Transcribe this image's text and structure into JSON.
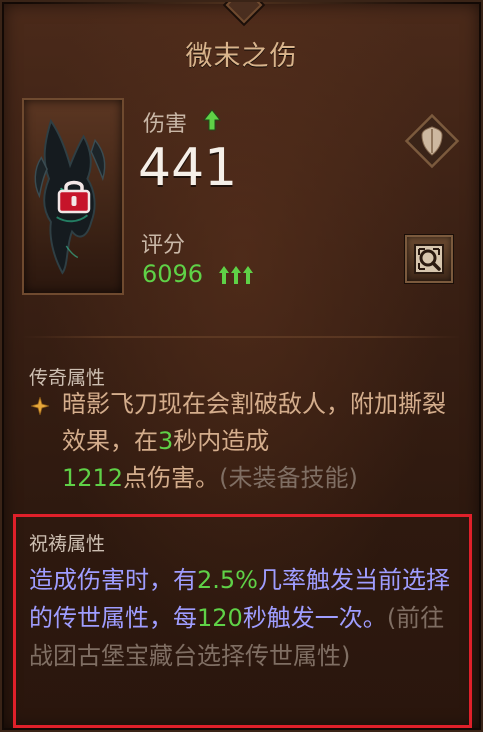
{
  "item": {
    "name": "微末之伤"
  },
  "stats": {
    "damage_label": "伤害",
    "damage_value": "441",
    "score_label": "评分",
    "score_value": "6096"
  },
  "icons": {
    "lock": "lock-icon",
    "compare": "shield-compare-icon",
    "inspect": "inspect-icon",
    "upgrade": "green-arrow-up-icon"
  },
  "colors": {
    "upgrade_green": "#5fd147",
    "prayer_blue": "#9f9dff",
    "highlight_red": "#e0202a",
    "lock_red": "#c6142a"
  },
  "legendary": {
    "header": "传奇属性",
    "text_part1": "暗影飞刀现在会割破敌人，附加撕裂效果，在",
    "text_num1": "3",
    "text_part2": "秒内造成",
    "text_num2": "1212",
    "text_part3": "点伤害。",
    "text_note": "(未装备技能)"
  },
  "prayer": {
    "header": "祝祷属性",
    "text_part1": "造成伤害时，有",
    "text_num1": "2.5%",
    "text_part2": "几率触发当前选择的传世属性，每",
    "text_num2": "120",
    "text_part3": "秒触发一次。",
    "text_note": "(前往战团古堡宝藏台选择传世属性)"
  }
}
